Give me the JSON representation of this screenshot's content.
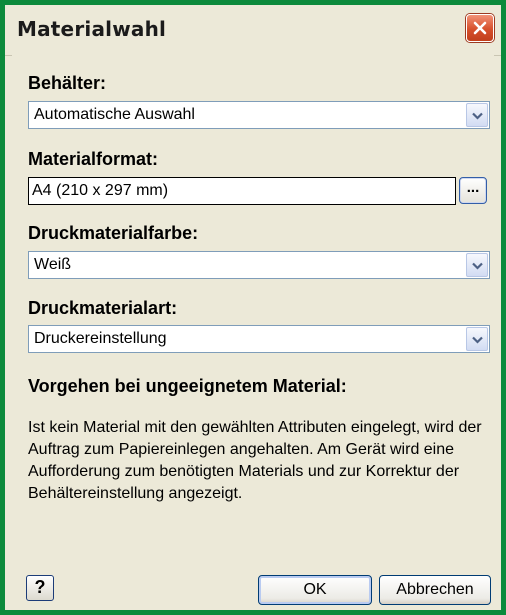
{
  "window": {
    "title": "Materialwahl",
    "close_icon": "close-icon"
  },
  "container": {
    "label": "Behälter:",
    "value": "Automatische Auswahl"
  },
  "format": {
    "label": "Materialformat:",
    "value": "A4 (210 x 297 mm)",
    "more_label": "..."
  },
  "color": {
    "label": "Druckmaterialfarbe:",
    "value": "Weiß"
  },
  "type": {
    "label": "Druckmaterialart:",
    "value": "Druckereinstellung"
  },
  "unsuitable": {
    "title": "Vorgehen bei ungeeignetem Material:",
    "description": "Ist kein Material mit den gewählten Attributen eingelegt, wird der Auftrag zum Papiereinlegen angehalten. Am Gerät wird eine Aufforderung zum benötigten Materials und zur Korrektur der Behältereinstellung angezeigt."
  },
  "buttons": {
    "help_label": "?",
    "ok_label": "OK",
    "cancel_label": "Abbrechen"
  },
  "colors": {
    "frame": "#0c8a3c",
    "dialog_bg": "#ece9d8",
    "close_button": "#d6502c",
    "field_border": "#7f9db9"
  }
}
